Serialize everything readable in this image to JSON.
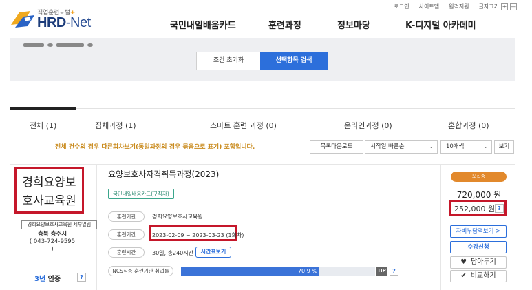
{
  "util": {
    "login": "로그인",
    "sitemap": "사이트맵",
    "remote": "원격지원",
    "font_size": "글자크기",
    "zoom_in": "+",
    "zoom_out": "—"
  },
  "logo": {
    "tagline": "직업훈련포털",
    "tagline_plus": "+",
    "brand": "HRD",
    "brand_dash": "-",
    "brand_net": "Net"
  },
  "nav": [
    {
      "label": "국민내일배움카드"
    },
    {
      "label": "훈련과정"
    },
    {
      "label": "정보마당"
    },
    {
      "label": "K-디지털 아카데미"
    }
  ],
  "search": {
    "reset_label": "조건 초기화",
    "search_label": "선택항목 검색"
  },
  "tabs": [
    {
      "label": "전체 (1)",
      "active": true
    },
    {
      "label": "집체과정 (1)",
      "active": false
    },
    {
      "label": "스마트 훈련 과정 (0)",
      "active": false
    },
    {
      "label": "온라인과정 (0)",
      "active": false
    },
    {
      "label": "혼합과정 (0)",
      "active": false
    }
  ],
  "notice": "전체 건수의 경우 다른회차보기(동일과정의 경우 묶음으로 표기) 포함입니다.",
  "toolbar": {
    "download": "목록다운로드",
    "sort": "시작일 빠른순",
    "per_page": "10개씩",
    "view": "보기"
  },
  "result": {
    "org_name_line1": "경희요양보",
    "org_name_line2": "호사교육원",
    "map_button": "경희요양보호사교육원 세부열림",
    "location": "충북 충주시",
    "phone": "( 043-724-9595 )",
    "cert_years": "3년",
    "cert_label": "인증",
    "help": "?",
    "title": "요양보호사자격취득과정(2023)",
    "card_badge": "국민내일배움카드(구직자)",
    "org_label": "훈련기관",
    "org_value": "경희요양보호사교육원",
    "period_label": "훈련기간",
    "period_value": "2023-02-09 ~ 2023-03-23 (1회차)",
    "hours_label": "훈련시간",
    "hours_value": "30일, 총240시간",
    "timetable_button": "시간표보기",
    "ncs_label": "NCS직종 훈련기관 취업률",
    "ncs_rate": 70.9,
    "ncs_rate_label": "70.9 %",
    "tip": "TIP",
    "status": "모집중",
    "price": "720,000 원",
    "self_pay": "252,000 원",
    "self_pay_button": "자비부담액보기 >",
    "apply_button": "수강신청",
    "save_button": "담아두기",
    "compare_button": "비교하기"
  },
  "colors": {
    "accent_blue": "#2c6fdb",
    "highlight_red": "#c5172a",
    "status_orange": "#e2892c",
    "notice_gold": "#c98a1c"
  }
}
